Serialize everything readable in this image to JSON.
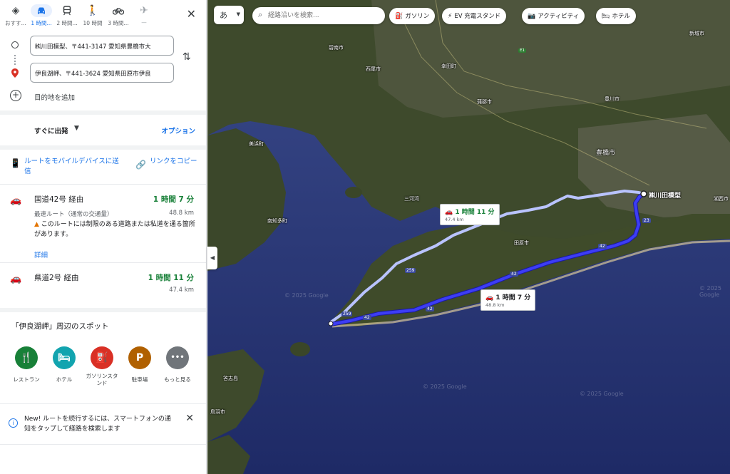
{
  "travel_modes": [
    {
      "label": "おすす...",
      "icon": "diamond-directions-icon"
    },
    {
      "label": "1 時間...",
      "icon": "car-icon",
      "active": true
    },
    {
      "label": "2 時間...",
      "icon": "train-icon"
    },
    {
      "label": "10 時間",
      "icon": "walk-icon"
    },
    {
      "label": "3 時間...",
      "icon": "bicycle-icon"
    },
    {
      "label": "—",
      "icon": "plane-icon",
      "muted": true
    }
  ],
  "origin": "㈱川田模型、〒441-3147 愛知県豊橋市大",
  "destination": "伊良湖岬、〒441-3624 愛知県田原市伊良",
  "add_destination": "目的地を追加",
  "depart": {
    "label": "すぐに出発",
    "options": "オプション"
  },
  "share": {
    "send_mobile": "ルートをモバイルデバイスに送信",
    "copy_link": "リンクをコピー"
  },
  "routes": [
    {
      "name": "国道42号 経由",
      "time": "1 時間 7 分",
      "subtitle": "最速ルート（通常の交通量）",
      "distance": "48.8 km",
      "warning": "このルートには制限のある道路または私道を通る箇所があります。",
      "details": "詳細"
    },
    {
      "name": "県道2号 経由",
      "time": "1 時間 11 分",
      "distance": "47.4 km"
    }
  ],
  "spots": {
    "title": "「伊良湖岬」周辺のスポット",
    "items": [
      {
        "label": "レストラン",
        "icon": "restaurant-icon",
        "color": "#188038",
        "glyph": "🍴"
      },
      {
        "label": "ホテル",
        "icon": "hotel-icon",
        "color": "#12a4af",
        "glyph": "🛏"
      },
      {
        "label": "ガソリンスタンド",
        "icon": "gas-station-icon",
        "color": "#d93025",
        "glyph": "⛽"
      },
      {
        "label": "駐車場",
        "icon": "parking-icon",
        "color": "#b06000",
        "glyph": "P"
      },
      {
        "label": "もっと見る",
        "icon": "more-icon",
        "color": "#70757a",
        "glyph": "•••"
      }
    ]
  },
  "notice": "New! ルートを続行するには、スマートフォンの通知をタップして経路を検索します",
  "map": {
    "lang_label": "あ",
    "search_placeholder": "経路沿いを検索...",
    "chips": [
      {
        "label": "ガソリン",
        "icon": "gas-icon"
      },
      {
        "label": "EV 充電スタンド",
        "icon": "ev-charging-icon"
      },
      {
        "label": "アクティビティ",
        "icon": "camera-icon"
      },
      {
        "label": "ホテル",
        "icon": "hotel-icon"
      }
    ],
    "route_label_selected": {
      "time": "1 時間 7 分",
      "distance": "48.8 km"
    },
    "route_label_alt": {
      "time": "1 時間 11 分",
      "distance": "47.4 km"
    },
    "destination_marker_label": "㈱川田模型",
    "places": [
      "豊橋市",
      "豊川市",
      "田原市",
      "蒲郡市",
      "幸田町",
      "美浜町",
      "南知多町",
      "西尾市",
      "碧南市",
      "三河湾",
      "新城市",
      "湖西市",
      "答志島",
      "鳥羽市"
    ],
    "watermark": "© 2025 Google",
    "colors": {
      "route": "#3d3df5",
      "alt_route": "#b9c3ff",
      "water": "#2f3b7a",
      "land": "#3e4a2c"
    }
  }
}
